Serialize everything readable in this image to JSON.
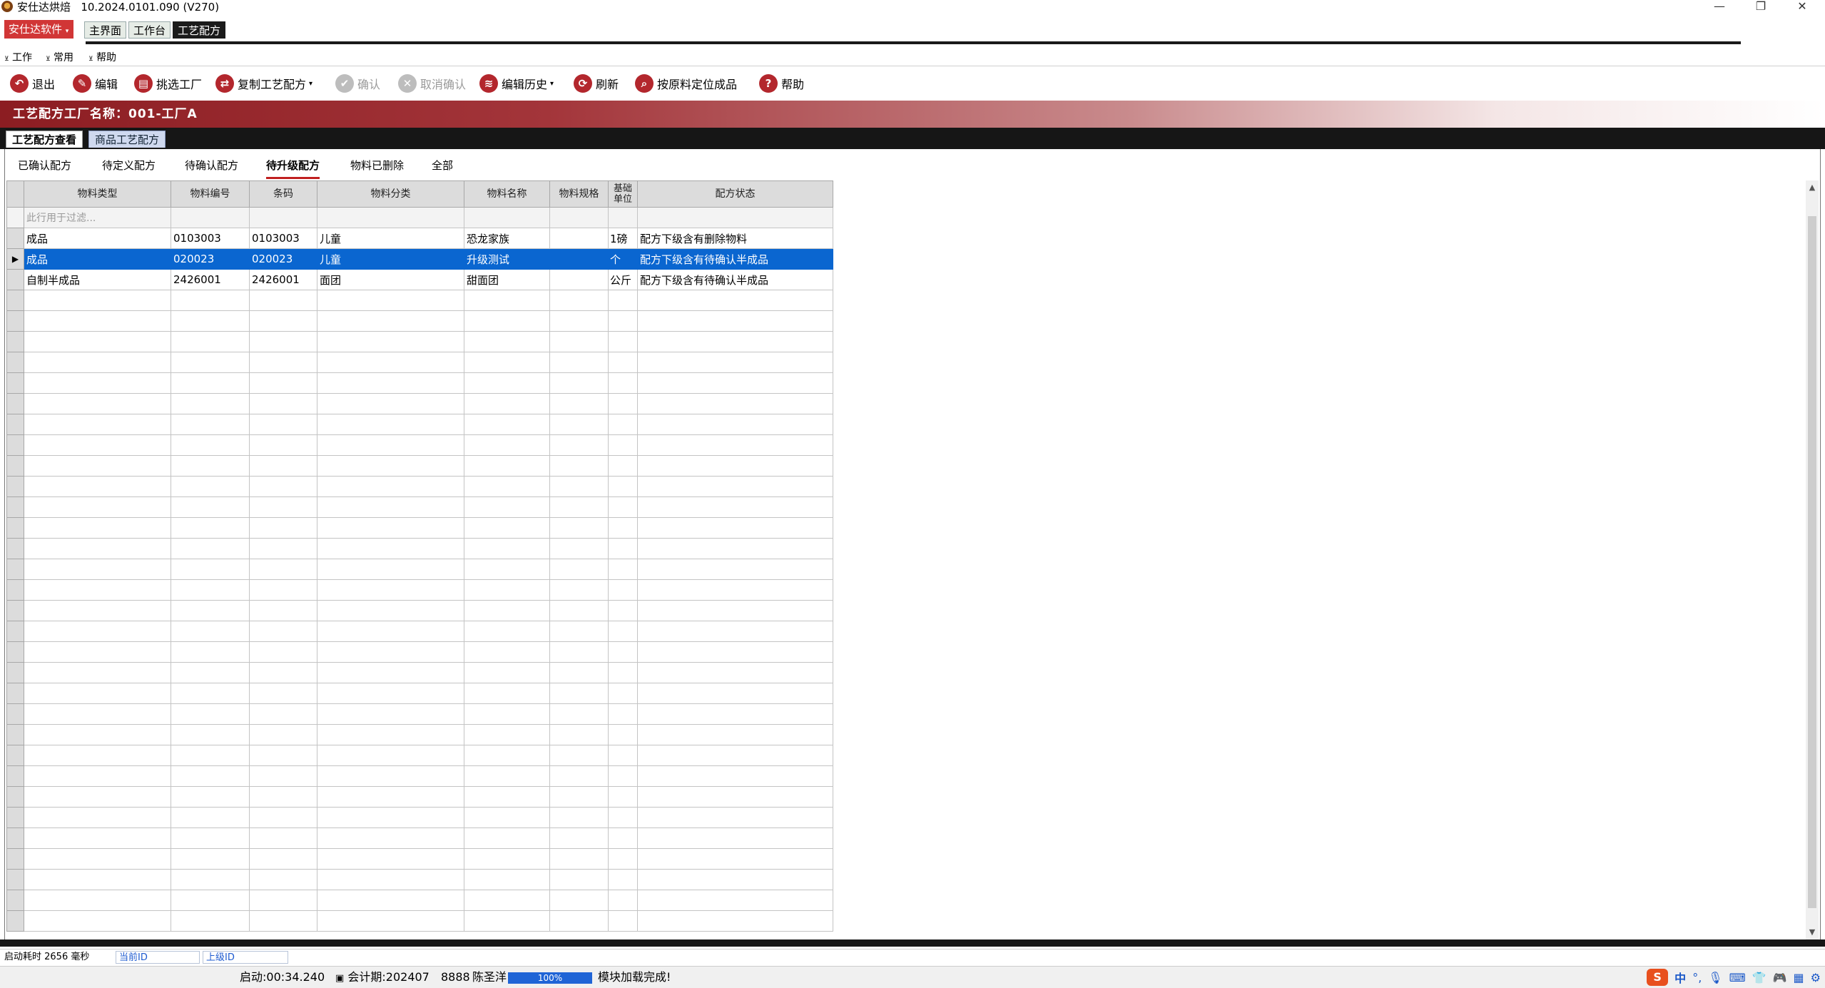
{
  "window": {
    "app_name": "安仕达烘焙",
    "version": "10.2024.0101.090 (V270)",
    "min": "—",
    "restore": "❐",
    "close": "✕"
  },
  "menu": {
    "brand": "安仕达软件",
    "tabs": [
      "主界面",
      "工作台",
      "工艺配方"
    ]
  },
  "ribbon_groups": [
    "工作",
    "常用",
    "帮助"
  ],
  "toolbar": {
    "exit": "退出",
    "edit": "编辑",
    "pick_factory": "挑选工厂",
    "copy_recipe": "复制工艺配方",
    "confirm": "确认",
    "cancel_confirm": "取消确认",
    "edit_history": "编辑历史",
    "refresh": "刷新",
    "locate": "按原料定位成品",
    "help": "帮助"
  },
  "banner": {
    "title": "工艺配方工厂名称：001-工厂A"
  },
  "main_tabs": [
    "工艺配方查看",
    "商品工艺配方"
  ],
  "sub_tabs": [
    "已确认配方",
    "待定义配方",
    "待确认配方",
    "待升级配方",
    "物料已删除",
    "全部"
  ],
  "grid": {
    "columns": [
      "物料类型",
      "物料编号",
      "条码",
      "物料分类",
      "物料名称",
      "物料规格",
      "基础单位",
      "配方状态"
    ],
    "filter_hint": "此行用于过滤...",
    "rows": [
      [
        "成品",
        "0103003",
        "0103003",
        "儿童",
        "恐龙家族",
        "",
        "1磅",
        "配方下级含有删除物料"
      ],
      [
        "成品",
        "020023",
        "020023",
        "儿童",
        "升级测试",
        "",
        "个",
        "配方下级含有待确认半成品"
      ],
      [
        "自制半成品",
        "2426001",
        "2426001",
        "面团",
        "甜面团",
        "",
        "公斤",
        "配方下级含有待确认半成品"
      ]
    ]
  },
  "status_bar": {
    "startup": "启动耗时 2656 毫秒",
    "current_id": "当前ID",
    "parent_id": "上级ID",
    "start_time": "启动:00:34.240",
    "period": "会计期:202407",
    "user_code": "8888",
    "user_name": "陈圣洋",
    "progress": "100%",
    "message": "模块加载完成!"
  },
  "tray": {
    "ime": "中"
  }
}
